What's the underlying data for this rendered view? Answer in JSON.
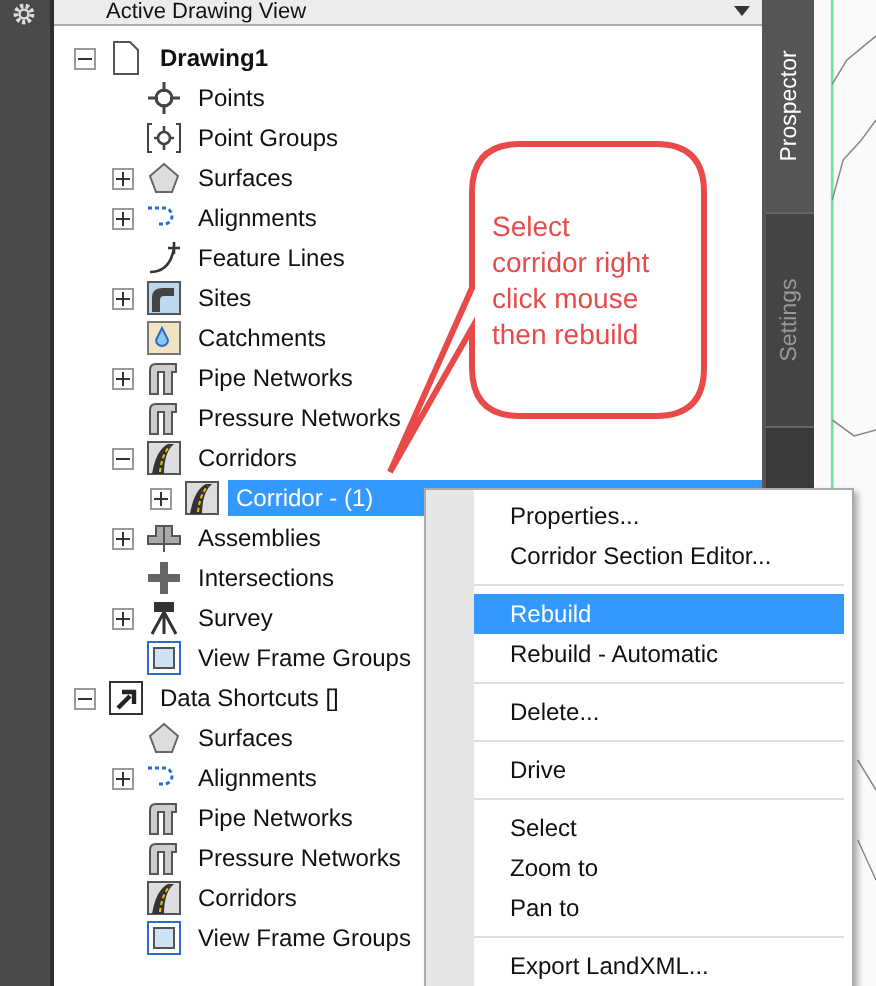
{
  "view_selector": {
    "value": "Active Drawing View"
  },
  "tree": [
    {
      "label": "Drawing1",
      "kind": "drawing",
      "expanded": true,
      "selected": false,
      "children": [
        {
          "label": "Points",
          "kind": "points",
          "selected": false
        },
        {
          "label": "Point Groups",
          "kind": "point-groups",
          "selected": false
        },
        {
          "label": "Surfaces",
          "kind": "surface",
          "expanded": false,
          "selected": false
        },
        {
          "label": "Alignments",
          "kind": "alignment",
          "expanded": false,
          "selected": false
        },
        {
          "label": "Feature Lines",
          "kind": "feature-line",
          "selected": false
        },
        {
          "label": "Sites",
          "kind": "site",
          "expanded": false,
          "selected": false
        },
        {
          "label": "Catchments",
          "kind": "catchment",
          "selected": false
        },
        {
          "label": "Pipe Networks",
          "kind": "pipe",
          "expanded": false,
          "selected": false
        },
        {
          "label": "Pressure Networks",
          "kind": "pipe",
          "selected": false
        },
        {
          "label": "Corridors",
          "kind": "corridor",
          "expanded": true,
          "selected": false,
          "children": [
            {
              "label": "Corridor - (1)",
              "kind": "corridor",
              "expanded": false,
              "selected": true
            }
          ]
        },
        {
          "label": "Assemblies",
          "kind": "assembly",
          "expanded": false,
          "selected": false
        },
        {
          "label": "Intersections",
          "kind": "intersection",
          "selected": false
        },
        {
          "label": "Survey",
          "kind": "survey",
          "expanded": false,
          "selected": false
        },
        {
          "label": "View Frame Groups",
          "kind": "view-frame",
          "selected": false
        }
      ]
    },
    {
      "label": "Data Shortcuts []",
      "kind": "shortcut",
      "expanded": true,
      "selected": false,
      "children": [
        {
          "label": "Surfaces",
          "kind": "surface",
          "selected": false
        },
        {
          "label": "Alignments",
          "kind": "alignment",
          "expanded": false,
          "selected": false
        },
        {
          "label": "Pipe Networks",
          "kind": "pipe",
          "selected": false
        },
        {
          "label": "Pressure Networks",
          "kind": "pipe",
          "selected": false
        },
        {
          "label": "Corridors",
          "kind": "corridor",
          "selected": false
        },
        {
          "label": "View Frame Groups",
          "kind": "view-frame",
          "selected": false
        }
      ]
    }
  ],
  "side_tabs": [
    {
      "label": "Prospector",
      "selected": true
    },
    {
      "label": "Settings",
      "selected": false
    }
  ],
  "callout": {
    "text": "Select corridor right click mouse then rebuild"
  },
  "context_menu": {
    "groups": [
      [
        {
          "label": "Properties...",
          "selected": false
        },
        {
          "label": "Corridor Section Editor...",
          "selected": false
        }
      ],
      [
        {
          "label": "Rebuild",
          "selected": true
        },
        {
          "label": "Rebuild - Automatic",
          "selected": false
        }
      ],
      [
        {
          "label": "Delete...",
          "selected": false
        }
      ],
      [
        {
          "label": "Drive",
          "selected": false
        }
      ],
      [
        {
          "label": "Select",
          "selected": false
        },
        {
          "label": "Zoom to",
          "selected": false
        },
        {
          "label": "Pan to",
          "selected": false
        }
      ],
      [
        {
          "label": "Export LandXML...",
          "selected": false
        }
      ]
    ]
  }
}
